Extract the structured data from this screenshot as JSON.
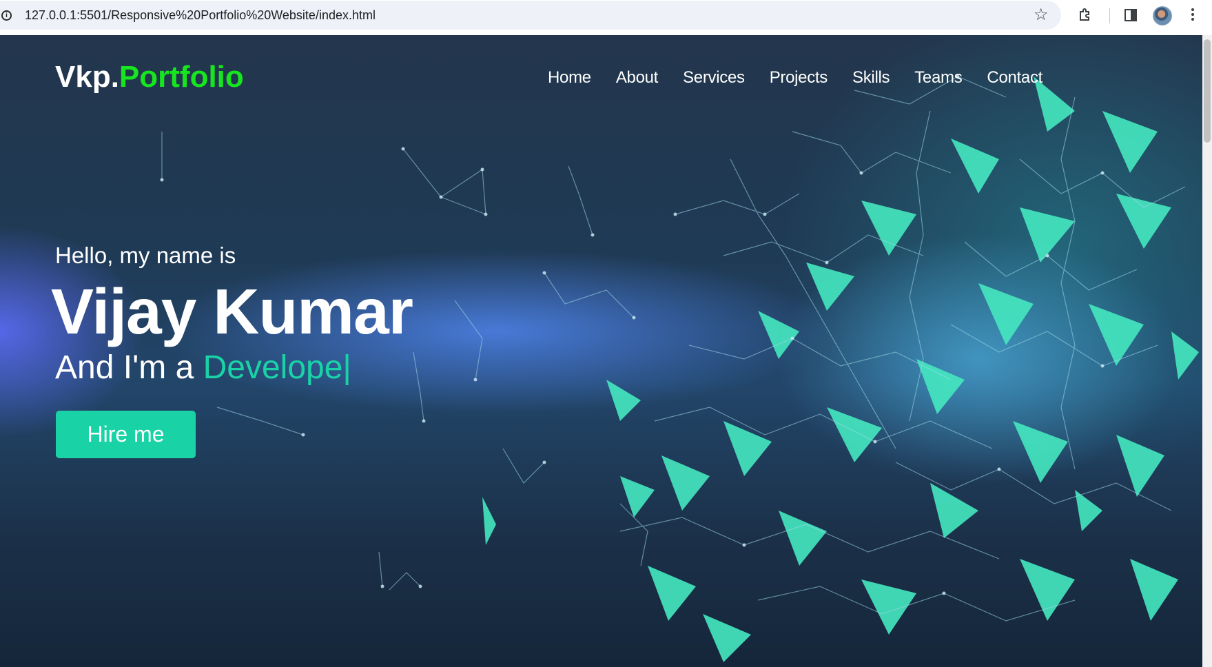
{
  "browser": {
    "url": "127.0.0.1:5501/Responsive%20Portfolio%20Website/index.html",
    "icons": [
      "info-icon",
      "star-icon",
      "extensions-icon",
      "side-panel-icon",
      "profile-avatar",
      "kebab-menu-icon"
    ]
  },
  "site": {
    "logo_main": "Vkp.",
    "logo_accent": "Portfolio",
    "nav": [
      "Home",
      "About",
      "Services",
      "Projects",
      "Skills",
      "Teams",
      "Contact"
    ]
  },
  "hero": {
    "greeting": "Hello, my name is",
    "name": "Vijay Kumar",
    "role_prefix": "And I'm a ",
    "role_typed": "Develope",
    "cursor": "|",
    "cta": "Hire me"
  },
  "colors": {
    "logo_accent": "#17e51f",
    "typed_text": "#19d3a6",
    "button_bg": "#19d3a6"
  }
}
